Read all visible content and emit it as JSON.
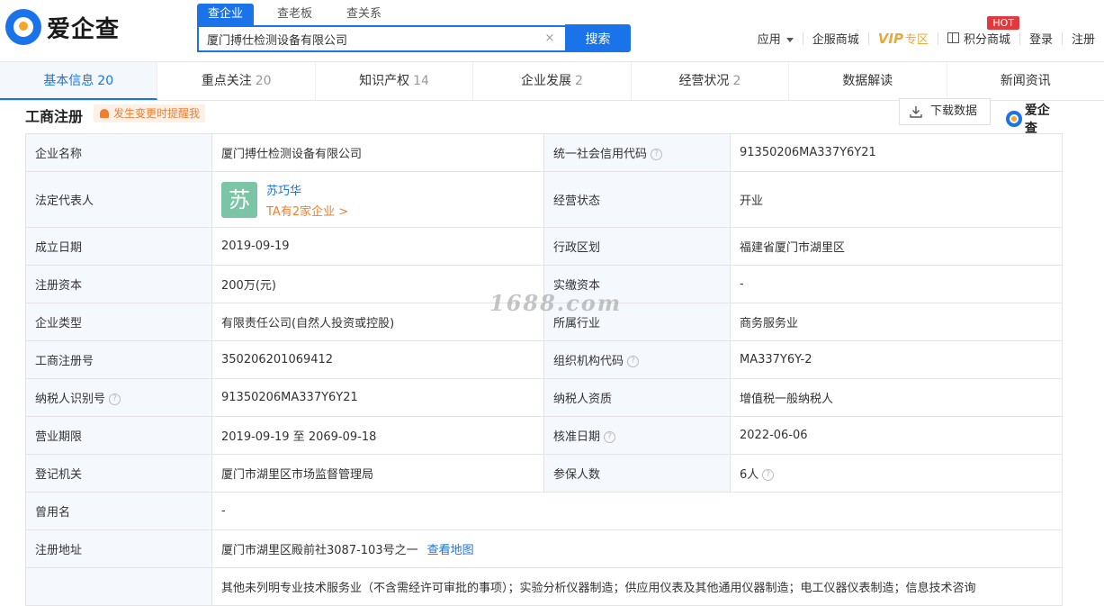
{
  "logo": {
    "text": "爱企查"
  },
  "search": {
    "tabs": [
      "查企业",
      "查老板",
      "查关系"
    ],
    "value": "厦门搏仕检测设备有限公司",
    "clear_glyph": "×",
    "button": "搜索"
  },
  "nav": {
    "apps": "应用",
    "mall": "企服商城",
    "vip": "VIP",
    "vip_zone": "专区",
    "points_mall": "积分商城",
    "hot": "HOT",
    "login": "登录",
    "register": "注册"
  },
  "tabs": [
    {
      "label": "基本信息",
      "count": "20"
    },
    {
      "label": "重点关注",
      "count": "20"
    },
    {
      "label": "知识产权",
      "count": "14"
    },
    {
      "label": "企业发展",
      "count": "2"
    },
    {
      "label": "经营状况",
      "count": "2"
    },
    {
      "label": "数据解读",
      "count": ""
    },
    {
      "label": "新闻资讯",
      "count": ""
    }
  ],
  "section": {
    "title": "工商注册",
    "remind": "发生变更时提醒我",
    "download": "下载数据",
    "logo_text": "爱企查"
  },
  "info": {
    "company_name_label": "企业名称",
    "company_name": "厦门搏仕检测设备有限公司",
    "credit_code_label": "统一社会信用代码",
    "credit_code": "91350206MA337Y6Y21",
    "legal_rep_label": "法定代表人",
    "legal_rep_avatar": "苏",
    "legal_rep_name": "苏巧华",
    "legal_rep_more": "TA有2家企业 >",
    "status_label": "经营状态",
    "status": "开业",
    "found_date_label": "成立日期",
    "found_date": "2019-09-19",
    "region_label": "行政区划",
    "region": "福建省厦门市湖里区",
    "reg_capital_label": "注册资本",
    "reg_capital": "200万(元)",
    "paid_capital_label": "实缴资本",
    "paid_capital": "-",
    "type_label": "企业类型",
    "type": "有限责任公司(自然人投资或控股)",
    "industry_label": "所属行业",
    "industry": "商务服务业",
    "reg_no_label": "工商注册号",
    "reg_no": "350206201069412",
    "org_code_label": "组织机构代码",
    "org_code": "MA337Y6Y-2",
    "taxpayer_id_label": "纳税人识别号",
    "taxpayer_id": "91350206MA337Y6Y21",
    "taxpayer_qual_label": "纳税人资质",
    "taxpayer_qual": "增值税一般纳税人",
    "term_label": "营业期限",
    "term": "2019-09-19 至 2069-09-18",
    "approve_date_label": "核准日期",
    "approve_date": "2022-06-06",
    "authority_label": "登记机关",
    "authority": "厦门市湖里区市场监督管理局",
    "insured_label": "参保人数",
    "insured": "6人",
    "former_name_label": "曾用名",
    "former_name": "-",
    "address_label": "注册地址",
    "address": "厦门市湖里区殿前社3087-103号之一",
    "map_link": "查看地图",
    "scope": "其他未列明专业技术服务业（不含需经许可审批的事项）；实验分析仪器制造；供应用仪表及其他通用仪器制造；电工仪器仪表制造；信息技术咨询"
  },
  "watermark": "1688.com",
  "colors": {
    "accent": "#1a73e8",
    "orange": "#f27d2e",
    "vip": "#e8a93b",
    "hot": "#e4393c",
    "avatar": "#7cc4a6"
  }
}
